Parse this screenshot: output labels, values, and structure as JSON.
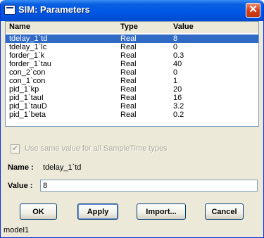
{
  "window": {
    "title": "SIM: Parameters",
    "close_glyph": "✕"
  },
  "table": {
    "headers": {
      "name": "Name",
      "type": "Type",
      "value": "Value"
    },
    "rows": [
      {
        "name": "tdelay_1`td",
        "type": "Real",
        "value": "8"
      },
      {
        "name": "tdelay_1`lc",
        "type": "Real",
        "value": "0"
      },
      {
        "name": "forder_1`k",
        "type": "Real",
        "value": "0.3"
      },
      {
        "name": "forder_1`tau",
        "type": "Real",
        "value": "40"
      },
      {
        "name": "con_2`con",
        "type": "Real",
        "value": "0"
      },
      {
        "name": "con_1`con",
        "type": "Real",
        "value": "1"
      },
      {
        "name": "pid_1`kp",
        "type": "Real",
        "value": "20"
      },
      {
        "name": "pid_1`tauI",
        "type": "Real",
        "value": "16"
      },
      {
        "name": "pid_1`tauD",
        "type": "Real",
        "value": "3.2"
      },
      {
        "name": "pid_1`beta",
        "type": "Real",
        "value": "0.2"
      }
    ],
    "selected_index": 0
  },
  "options": {
    "same_value_label": "Use same value for all SampleTime types",
    "same_value_checked": true,
    "check_glyph": "✔"
  },
  "fields": {
    "name_label": "Name :",
    "name_value": "tdelay_1`td",
    "value_label": "Value :",
    "value_value": "8"
  },
  "buttons": {
    "ok": "OK",
    "apply": "Apply",
    "import": "Import...",
    "cancel": "Cancel"
  },
  "status": {
    "text": "model1"
  },
  "colors": {
    "selection": "#316ac5",
    "title_blue": "#0058e6",
    "dialog_bg": "#ece9d8",
    "close_red": "#d8401c"
  },
  "icons": {
    "title": "window-icon",
    "close": "close-icon",
    "check": "checkmark-icon"
  }
}
